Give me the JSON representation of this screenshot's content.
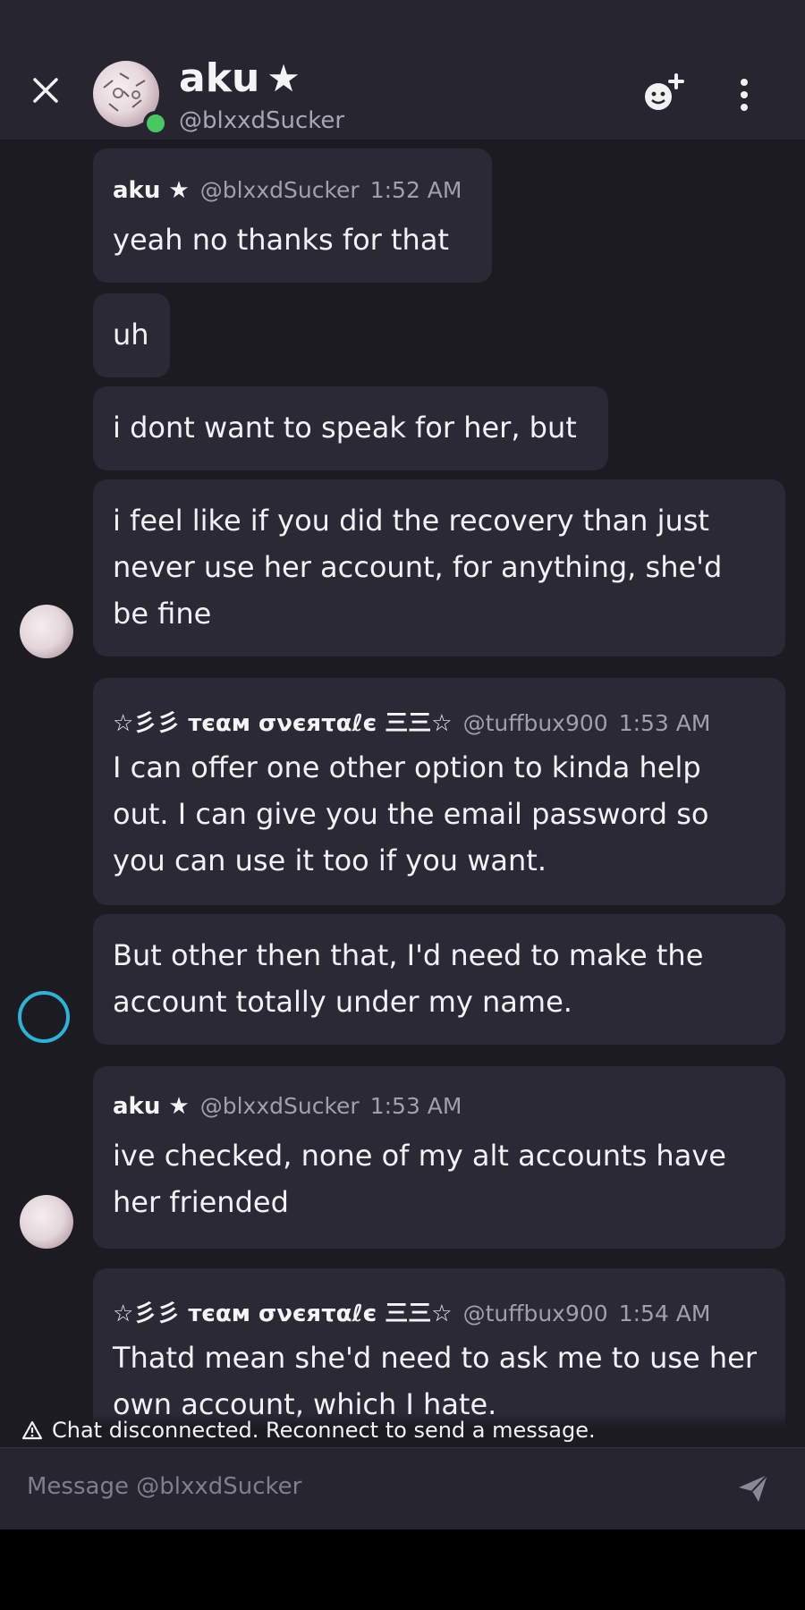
{
  "header": {
    "name": "aku",
    "star": "★",
    "handle": "@blxxdSucker"
  },
  "messages": [
    {
      "author": "aku ★",
      "handle": "@blxxdSucker",
      "time": "1:52 AM",
      "text": "yeah no thanks for that"
    },
    {
      "text": "uh"
    },
    {
      "text": "i dont want to speak for her, but"
    },
    {
      "text": "i feel like if you did the recovery than just never use her account, for anything, she'd be fine"
    },
    {
      "author": "☆彡彡 ᴛєαм σνєяταℓє 三三☆",
      "handle": "@tuffbux900",
      "time": "1:53 AM",
      "text": "I can offer one other option to kinda help out. I can give you the email password so you can use it too if you want."
    },
    {
      "text": "But other then that, I'd need to make the account totally under my name."
    },
    {
      "author": "aku ★",
      "handle": "@blxxdSucker",
      "time": "1:53 AM",
      "text": "ive checked, none of my alt accounts have her friended"
    },
    {
      "author": "☆彡彡 ᴛєαм σνєяταℓє 三三☆",
      "handle": "@tuffbux900",
      "time": "1:54 AM",
      "text": "Thatd mean she'd need to ask me to use her own account, which I hate."
    }
  ],
  "status": {
    "text": "Chat disconnected. Reconnect to send a message."
  },
  "composer": {
    "placeholder": "Message @blxxdSucker"
  },
  "colors": {
    "background": "#1d1b22",
    "bubble": "#2b2936",
    "header": "#27252f",
    "online": "#47c860",
    "ring": "#2bb3d8"
  }
}
